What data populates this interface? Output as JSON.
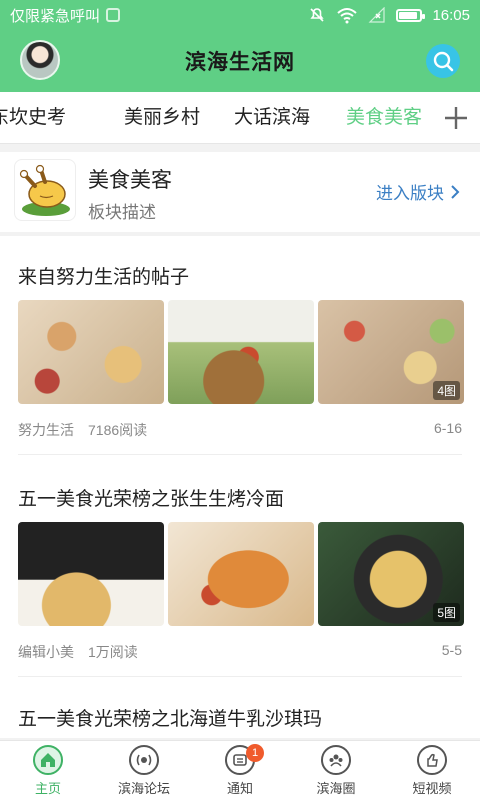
{
  "status_bar": {
    "left_text": "仅限紧急呼叫",
    "time": "16:05",
    "battery_level": 0.8
  },
  "header": {
    "title": "滨海生活网",
    "avatar_icon": "avatar",
    "search_icon": "search-icon",
    "accent_color": "#5fcf85"
  },
  "tabs": [
    {
      "label": "东坎史考",
      "active": false
    },
    {
      "label": "美丽乡村",
      "active": false
    },
    {
      "label": "大话滨海",
      "active": false
    },
    {
      "label": "美食美客",
      "active": true
    }
  ],
  "board": {
    "name": "美食美客",
    "description": "板块描述",
    "enter_label": "进入版块",
    "icon": "roast-chicken-icon"
  },
  "posts": [
    {
      "title": "来自努力生活的帖子",
      "author": "努力生活",
      "views": "7186阅读",
      "date": "6-16",
      "image_count_label": "4图"
    },
    {
      "title": "五一美食光荣榜之张生生烤冷面",
      "author": "编辑小美",
      "views": "1万阅读",
      "date": "5-5",
      "image_count_label": "5图"
    },
    {
      "title": "五一美食光荣榜之北海道牛乳沙琪玛"
    }
  ],
  "bottom_nav": [
    {
      "label": "主页",
      "icon": "home-icon",
      "active": true
    },
    {
      "label": "滨海论坛",
      "icon": "forum-icon",
      "active": false
    },
    {
      "label": "通知",
      "icon": "notification-icon",
      "active": false,
      "badge": "1"
    },
    {
      "label": "滨海圈",
      "icon": "group-icon",
      "active": false
    },
    {
      "label": "短视频",
      "icon": "video-icon",
      "active": false
    }
  ]
}
